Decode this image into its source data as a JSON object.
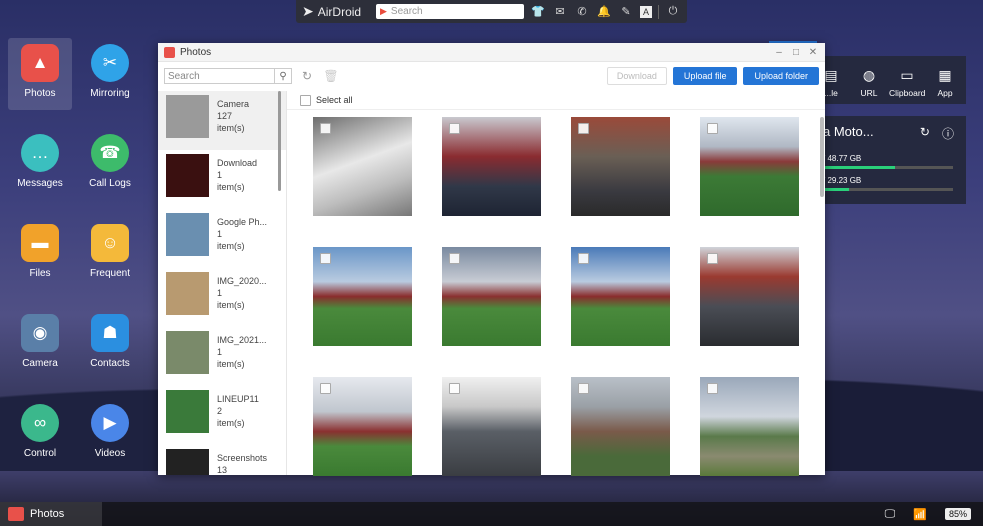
{
  "topbar": {
    "brand": "AirDroid",
    "search_placeholder": "Search",
    "icons": [
      "shirt-icon",
      "mail-icon",
      "phone-icon",
      "bell-icon",
      "pen-icon",
      "text-icon",
      "power-icon"
    ]
  },
  "desktop": [
    {
      "label": "Photos",
      "color": "#e8514a",
      "name": "photos",
      "glyph": "▲",
      "shape": "sq"
    },
    {
      "label": "Mirroring",
      "color": "#2fa3e8",
      "name": "mirroring",
      "glyph": "✂",
      "shape": "round"
    },
    {
      "label": "Messages",
      "color": "#3bbfbf",
      "name": "messages",
      "glyph": "…",
      "shape": "round"
    },
    {
      "label": "Call Logs",
      "color": "#3dbb6b",
      "name": "call-logs",
      "glyph": "☎",
      "shape": "round"
    },
    {
      "label": "Files",
      "color": "#f1a22a",
      "name": "files",
      "glyph": "▬",
      "shape": "sq"
    },
    {
      "label": "Frequent",
      "color": "#f4b93a",
      "name": "frequent",
      "glyph": "☺",
      "shape": "sq"
    },
    {
      "label": "Camera",
      "color": "#5a7fa8",
      "name": "camera",
      "glyph": "◉",
      "shape": "sq"
    },
    {
      "label": "Contacts",
      "color": "#2b8fe0",
      "name": "contacts",
      "glyph": "☗",
      "shape": "sq"
    },
    {
      "label": "Control",
      "color": "#3bb88c",
      "name": "control",
      "glyph": "∞",
      "shape": "round"
    },
    {
      "label": "Videos",
      "color": "#4a86e8",
      "name": "videos",
      "glyph": "▶",
      "shape": "round"
    }
  ],
  "window": {
    "title": "Photos",
    "search_placeholder": "Search",
    "download_label": "Download",
    "upload_file_label": "Upload file",
    "upload_folder_label": "Upload folder",
    "select_all": "Select all"
  },
  "albums": [
    {
      "name": "Camera",
      "count": "127",
      "unit": "item(s)",
      "color": "#9a9a9a"
    },
    {
      "name": "Download",
      "count": "1",
      "unit": "item(s)",
      "color": "#3a1010"
    },
    {
      "name": "Google Ph...",
      "count": "1",
      "unit": "item(s)",
      "color": "#6a8fb0"
    },
    {
      "name": "IMG_2020...",
      "count": "1",
      "unit": "item(s)",
      "color": "#b89a70"
    },
    {
      "name": "IMG_2021...",
      "count": "1",
      "unit": "item(s)",
      "color": "#7a8a6a"
    },
    {
      "name": "LINEUP11",
      "count": "2",
      "unit": "item(s)",
      "color": "#3a7a3a"
    },
    {
      "name": "Screenshots",
      "count": "13",
      "unit": "item(s)",
      "color": "#222"
    }
  ],
  "photos": [
    {
      "name": "dog",
      "bg": "linear-gradient(160deg,#6d6d6d,#e8e8e8 45%,#bdbdbd 70%,#777)"
    },
    {
      "name": "selfie",
      "bg": "linear-gradient(180deg,#c9c9cf 0%,#8a2b30 40%,#303848 70%,#1e2433)"
    },
    {
      "name": "stand-crowd",
      "bg": "linear-gradient(180deg,#9a4a3a 0%,#6a5f55 40%,#3a3a40 75%,#2a2a2a)"
    },
    {
      "name": "stadium-1",
      "bg": "linear-gradient(180deg,#dfe6ee 0%,#b0b8c4 30%,#8a3a3a 45%,#3c7a36 60%,#2f6a2c)"
    },
    {
      "name": "stadium-2",
      "bg": "linear-gradient(180deg,#6a96c8 0%,#b9cbe0 35%,#8a2c2c 50%,#4a8a3c 62%,#3a7a30)"
    },
    {
      "name": "stadium-3",
      "bg": "linear-gradient(180deg,#7a8aa0 0%,#c8ccd4 35%,#8a3030 50%,#4a8a3c 62%,#3a7a30)"
    },
    {
      "name": "stadium-4",
      "bg": "linear-gradient(180deg,#4a7ab8 0%,#b9cbe0 35%,#8a2c2c 50%,#4a8a3c 62%,#3a7a30)"
    },
    {
      "name": "man-in-stand",
      "bg": "linear-gradient(180deg,#d0d4da 0%,#9a3a30 30%,#4a4d55 60%,#2a2c30)"
    },
    {
      "name": "stadium-5",
      "bg": "linear-gradient(180deg,#e6e9ee 0%,#c0c6ce 35%,#8a3030 55%,#4a8a3c 70%,#3a7a30)"
    },
    {
      "name": "dog-floor",
      "bg": "linear-gradient(180deg,#f0f0f0 0%,#c8c8c8 30%,#5a5f66 55%,#3a3d42)"
    },
    {
      "name": "houses",
      "bg": "linear-gradient(180deg,#b9c0c8 0%,#9aa0a6 30%,#7a5a4a 55%,#4a6a3a 80%)"
    },
    {
      "name": "path-field",
      "bg": "linear-gradient(180deg,#9aa8ba 0%,#d0d6de 40%,#5a7a4a 60%,#8a8a70 80%,#5a7a3a)"
    }
  ],
  "side_panel": {
    "buttons": [
      {
        "label": "...le",
        "icon": "file-icon",
        "glyph": "▤"
      },
      {
        "label": "URL",
        "icon": "globe-icon",
        "glyph": "◍"
      },
      {
        "label": "Clipboard",
        "icon": "clipboard-icon",
        "glyph": "▭"
      },
      {
        "label": "App",
        "icon": "app-icon",
        "glyph": "▦"
      }
    ],
    "device_name": "a Moto...",
    "storage_1": "/ 48.77 GB",
    "storage_2": "/ 29.23 GB",
    "storage_1_fill": 0.55,
    "storage_2_fill": 0.2
  },
  "taskbar": {
    "active_app": "Photos",
    "battery": "85%"
  }
}
